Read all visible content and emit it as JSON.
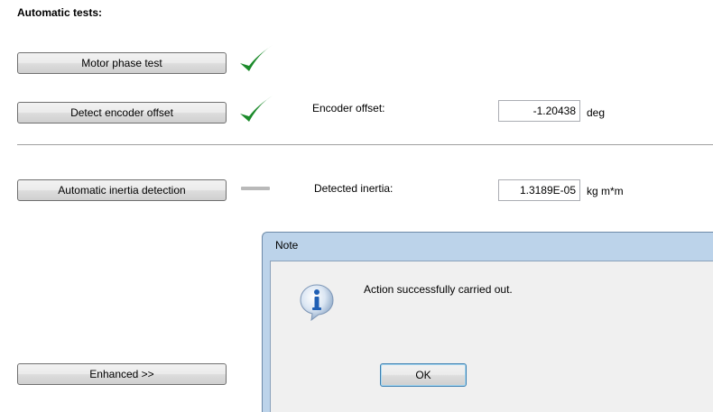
{
  "section_title": "Automatic tests:",
  "tests": {
    "motor_phase_button": "Motor phase test",
    "encoder_offset_button": "Detect encoder offset",
    "inertia_button": "Automatic inertia detection"
  },
  "encoder_offset": {
    "label": "Encoder offset:",
    "value": "-1.20438",
    "unit": "deg"
  },
  "detected_inertia": {
    "label": "Detected inertia:",
    "value": "1.3189E-05",
    "unit": "kg m*m"
  },
  "enhanced_button": "Enhanced >>",
  "status_icons": {
    "motor_phase": "green-check",
    "encoder_offset": "green-check",
    "inertia": "gray-dash"
  },
  "dialog": {
    "title": "Note",
    "message": "Action successfully carried out.",
    "ok_label": "OK",
    "icon": "info-icon"
  },
  "colors": {
    "check": "#1b8a2a",
    "dash": "#b9b9b9",
    "dialog_frame": "#bcd3ea",
    "info_blue": "#1f5fb4"
  }
}
